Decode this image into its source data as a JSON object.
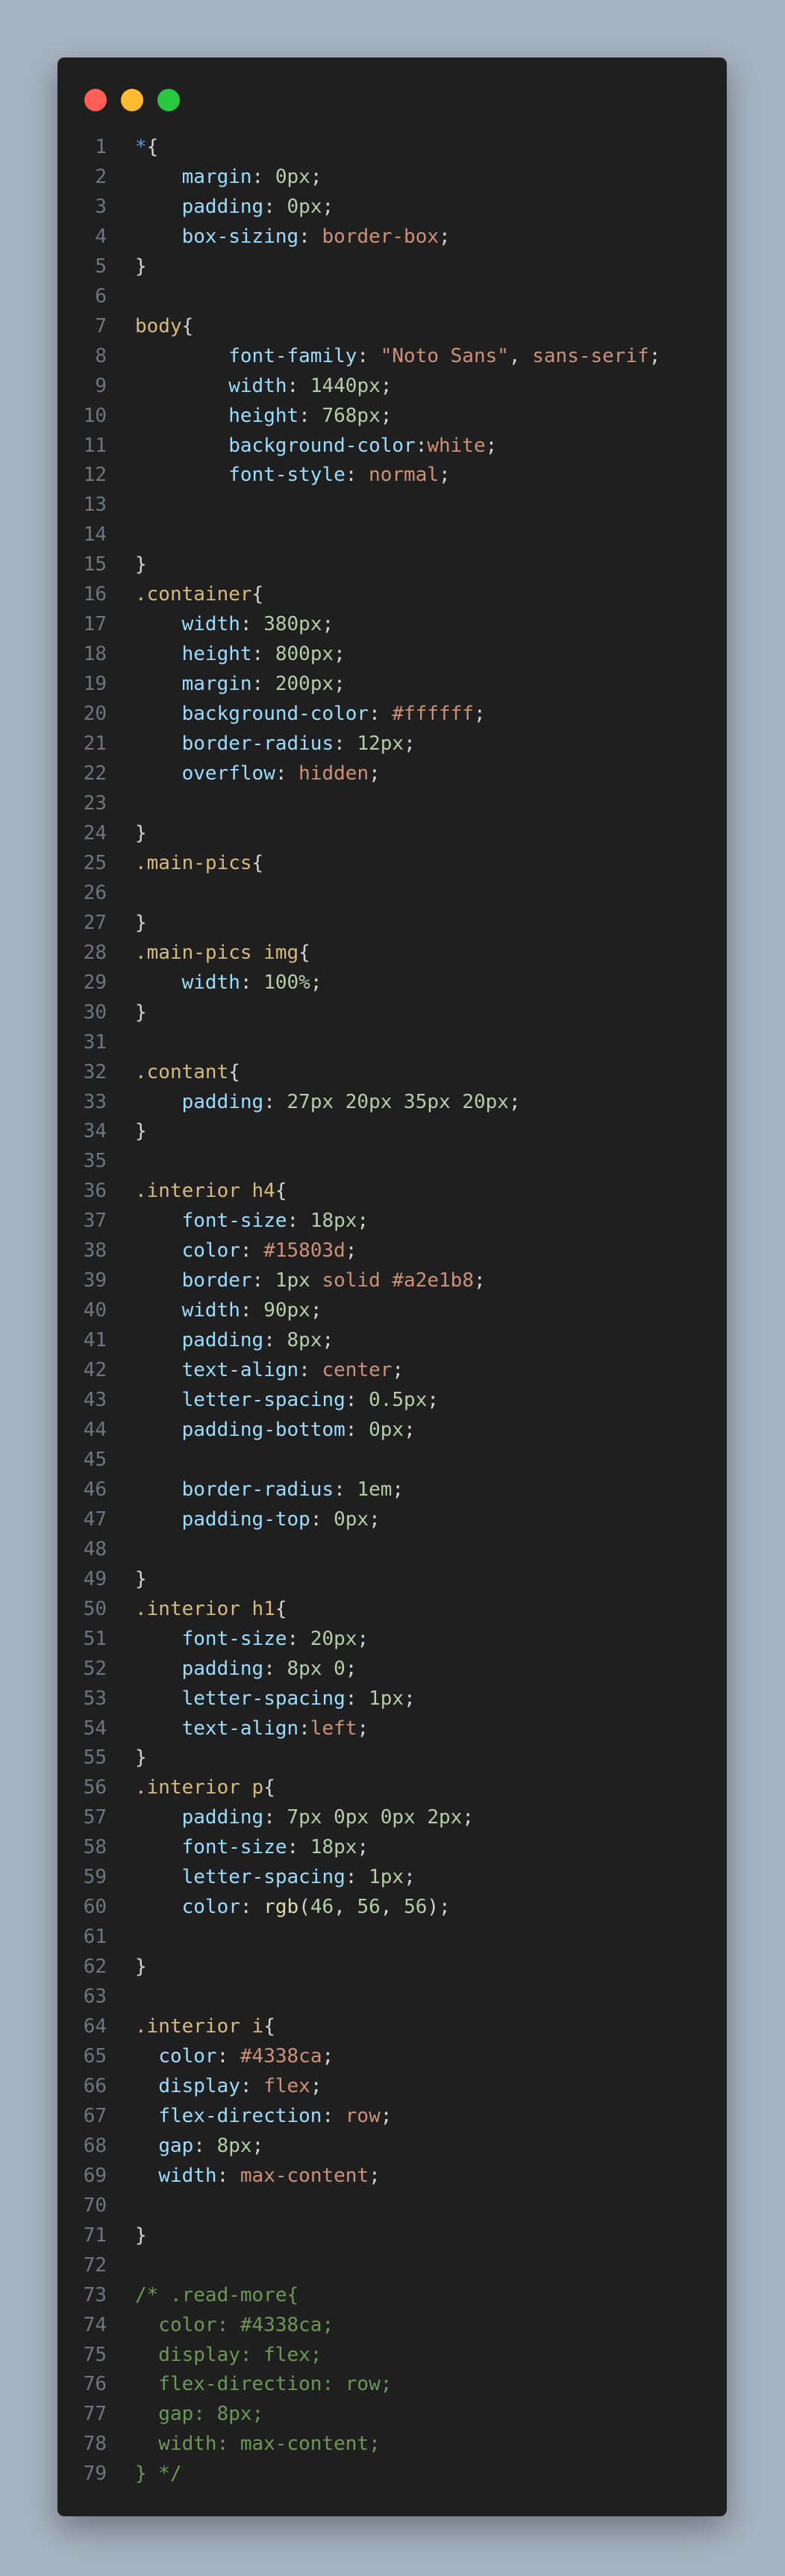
{
  "window": {
    "controls": [
      {
        "name": "close",
        "color": "#ff5f57"
      },
      {
        "name": "minimize",
        "color": "#febc2e"
      },
      {
        "name": "maximize",
        "color": "#28c840"
      }
    ]
  },
  "code": {
    "lines": [
      [
        {
          "t": "*",
          "c": "star"
        },
        {
          "t": "{",
          "c": "punc"
        }
      ],
      [
        {
          "t": "    ",
          "c": "plain"
        },
        {
          "t": "margin",
          "c": "prop"
        },
        {
          "t": ": ",
          "c": "punc"
        },
        {
          "t": "0px",
          "c": "num"
        },
        {
          "t": ";",
          "c": "punc"
        }
      ],
      [
        {
          "t": "    ",
          "c": "plain"
        },
        {
          "t": "padding",
          "c": "prop"
        },
        {
          "t": ": ",
          "c": "punc"
        },
        {
          "t": "0px",
          "c": "num"
        },
        {
          "t": ";",
          "c": "punc"
        }
      ],
      [
        {
          "t": "    ",
          "c": "plain"
        },
        {
          "t": "box-sizing",
          "c": "prop"
        },
        {
          "t": ": ",
          "c": "punc"
        },
        {
          "t": "border-box",
          "c": "val"
        },
        {
          "t": ";",
          "c": "punc"
        }
      ],
      [
        {
          "t": "}",
          "c": "punc"
        }
      ],
      [],
      [
        {
          "t": "body",
          "c": "sel"
        },
        {
          "t": "{",
          "c": "punc"
        }
      ],
      [
        {
          "t": "        ",
          "c": "plain"
        },
        {
          "t": "font-family",
          "c": "prop"
        },
        {
          "t": ": ",
          "c": "punc"
        },
        {
          "t": "\"Noto Sans\"",
          "c": "str"
        },
        {
          "t": ", ",
          "c": "punc"
        },
        {
          "t": "sans-serif",
          "c": "val"
        },
        {
          "t": ";",
          "c": "punc"
        }
      ],
      [
        {
          "t": "        ",
          "c": "plain"
        },
        {
          "t": "width",
          "c": "prop"
        },
        {
          "t": ": ",
          "c": "punc"
        },
        {
          "t": "1440px",
          "c": "num"
        },
        {
          "t": ";",
          "c": "punc"
        }
      ],
      [
        {
          "t": "        ",
          "c": "plain"
        },
        {
          "t": "height",
          "c": "prop"
        },
        {
          "t": ": ",
          "c": "punc"
        },
        {
          "t": "768px",
          "c": "num"
        },
        {
          "t": ";",
          "c": "punc"
        }
      ],
      [
        {
          "t": "        ",
          "c": "plain"
        },
        {
          "t": "background-color",
          "c": "prop"
        },
        {
          "t": ":",
          "c": "punc"
        },
        {
          "t": "white",
          "c": "val"
        },
        {
          "t": ";",
          "c": "punc"
        }
      ],
      [
        {
          "t": "        ",
          "c": "plain"
        },
        {
          "t": "font-style",
          "c": "prop"
        },
        {
          "t": ": ",
          "c": "punc"
        },
        {
          "t": "normal",
          "c": "val"
        },
        {
          "t": ";",
          "c": "punc"
        }
      ],
      [],
      [],
      [
        {
          "t": "}",
          "c": "punc"
        }
      ],
      [
        {
          "t": ".container",
          "c": "sel"
        },
        {
          "t": "{",
          "c": "punc"
        }
      ],
      [
        {
          "t": "    ",
          "c": "plain"
        },
        {
          "t": "width",
          "c": "prop"
        },
        {
          "t": ": ",
          "c": "punc"
        },
        {
          "t": "380px",
          "c": "num"
        },
        {
          "t": ";",
          "c": "punc"
        }
      ],
      [
        {
          "t": "    ",
          "c": "plain"
        },
        {
          "t": "height",
          "c": "prop"
        },
        {
          "t": ": ",
          "c": "punc"
        },
        {
          "t": "800px",
          "c": "num"
        },
        {
          "t": ";",
          "c": "punc"
        }
      ],
      [
        {
          "t": "    ",
          "c": "plain"
        },
        {
          "t": "margin",
          "c": "prop"
        },
        {
          "t": ": ",
          "c": "punc"
        },
        {
          "t": "200px",
          "c": "num"
        },
        {
          "t": ";",
          "c": "punc"
        }
      ],
      [
        {
          "t": "    ",
          "c": "plain"
        },
        {
          "t": "background-color",
          "c": "prop"
        },
        {
          "t": ": ",
          "c": "punc"
        },
        {
          "t": "#ffffff",
          "c": "val"
        },
        {
          "t": ";",
          "c": "punc"
        }
      ],
      [
        {
          "t": "    ",
          "c": "plain"
        },
        {
          "t": "border-radius",
          "c": "prop"
        },
        {
          "t": ": ",
          "c": "punc"
        },
        {
          "t": "12px",
          "c": "num"
        },
        {
          "t": ";",
          "c": "punc"
        }
      ],
      [
        {
          "t": "    ",
          "c": "plain"
        },
        {
          "t": "overflow",
          "c": "prop"
        },
        {
          "t": ": ",
          "c": "punc"
        },
        {
          "t": "hidden",
          "c": "val"
        },
        {
          "t": ";",
          "c": "punc"
        }
      ],
      [],
      [
        {
          "t": "}",
          "c": "punc"
        }
      ],
      [
        {
          "t": ".main-pics",
          "c": "sel"
        },
        {
          "t": "{",
          "c": "punc"
        }
      ],
      [],
      [
        {
          "t": "}",
          "c": "punc"
        }
      ],
      [
        {
          "t": ".main-pics img",
          "c": "sel"
        },
        {
          "t": "{",
          "c": "punc"
        }
      ],
      [
        {
          "t": "    ",
          "c": "plain"
        },
        {
          "t": "width",
          "c": "prop"
        },
        {
          "t": ": ",
          "c": "punc"
        },
        {
          "t": "100%",
          "c": "num"
        },
        {
          "t": ";",
          "c": "punc"
        }
      ],
      [
        {
          "t": "}",
          "c": "punc"
        }
      ],
      [],
      [
        {
          "t": ".contant",
          "c": "sel"
        },
        {
          "t": "{",
          "c": "punc"
        }
      ],
      [
        {
          "t": "    ",
          "c": "plain"
        },
        {
          "t": "padding",
          "c": "prop"
        },
        {
          "t": ": ",
          "c": "punc"
        },
        {
          "t": "27px 20px 35px 20px",
          "c": "num"
        },
        {
          "t": ";",
          "c": "punc"
        }
      ],
      [
        {
          "t": "}",
          "c": "punc"
        }
      ],
      [],
      [
        {
          "t": ".interior h4",
          "c": "sel"
        },
        {
          "t": "{",
          "c": "punc"
        }
      ],
      [
        {
          "t": "    ",
          "c": "plain"
        },
        {
          "t": "font-size",
          "c": "prop"
        },
        {
          "t": ": ",
          "c": "punc"
        },
        {
          "t": "18px",
          "c": "num"
        },
        {
          "t": ";",
          "c": "punc"
        }
      ],
      [
        {
          "t": "    ",
          "c": "plain"
        },
        {
          "t": "color",
          "c": "prop"
        },
        {
          "t": ": ",
          "c": "punc"
        },
        {
          "t": "#15803d",
          "c": "val"
        },
        {
          "t": ";",
          "c": "punc"
        }
      ],
      [
        {
          "t": "    ",
          "c": "plain"
        },
        {
          "t": "border",
          "c": "prop"
        },
        {
          "t": ": ",
          "c": "punc"
        },
        {
          "t": "1px",
          "c": "num"
        },
        {
          "t": " ",
          "c": "plain"
        },
        {
          "t": "solid #a2e1b8",
          "c": "val"
        },
        {
          "t": ";",
          "c": "punc"
        }
      ],
      [
        {
          "t": "    ",
          "c": "plain"
        },
        {
          "t": "width",
          "c": "prop"
        },
        {
          "t": ": ",
          "c": "punc"
        },
        {
          "t": "90px",
          "c": "num"
        },
        {
          "t": ";",
          "c": "punc"
        }
      ],
      [
        {
          "t": "    ",
          "c": "plain"
        },
        {
          "t": "padding",
          "c": "prop"
        },
        {
          "t": ": ",
          "c": "punc"
        },
        {
          "t": "8px",
          "c": "num"
        },
        {
          "t": ";",
          "c": "punc"
        }
      ],
      [
        {
          "t": "    ",
          "c": "plain"
        },
        {
          "t": "text-align",
          "c": "prop"
        },
        {
          "t": ": ",
          "c": "punc"
        },
        {
          "t": "center",
          "c": "val"
        },
        {
          "t": ";",
          "c": "punc"
        }
      ],
      [
        {
          "t": "    ",
          "c": "plain"
        },
        {
          "t": "letter-spacing",
          "c": "prop"
        },
        {
          "t": ": ",
          "c": "punc"
        },
        {
          "t": "0.5px",
          "c": "num"
        },
        {
          "t": ";",
          "c": "punc"
        }
      ],
      [
        {
          "t": "    ",
          "c": "plain"
        },
        {
          "t": "padding-bottom",
          "c": "prop"
        },
        {
          "t": ": ",
          "c": "punc"
        },
        {
          "t": "0px",
          "c": "num"
        },
        {
          "t": ";",
          "c": "punc"
        }
      ],
      [],
      [
        {
          "t": "    ",
          "c": "plain"
        },
        {
          "t": "border-radius",
          "c": "prop"
        },
        {
          "t": ": ",
          "c": "punc"
        },
        {
          "t": "1em",
          "c": "num"
        },
        {
          "t": ";",
          "c": "punc"
        }
      ],
      [
        {
          "t": "    ",
          "c": "plain"
        },
        {
          "t": "padding-top",
          "c": "prop"
        },
        {
          "t": ": ",
          "c": "punc"
        },
        {
          "t": "0px",
          "c": "num"
        },
        {
          "t": ";",
          "c": "punc"
        }
      ],
      [],
      [
        {
          "t": "}",
          "c": "punc"
        }
      ],
      [
        {
          "t": ".interior h1",
          "c": "sel"
        },
        {
          "t": "{",
          "c": "punc"
        }
      ],
      [
        {
          "t": "    ",
          "c": "plain"
        },
        {
          "t": "font-size",
          "c": "prop"
        },
        {
          "t": ": ",
          "c": "punc"
        },
        {
          "t": "20px",
          "c": "num"
        },
        {
          "t": ";",
          "c": "punc"
        }
      ],
      [
        {
          "t": "    ",
          "c": "plain"
        },
        {
          "t": "padding",
          "c": "prop"
        },
        {
          "t": ": ",
          "c": "punc"
        },
        {
          "t": "8px 0",
          "c": "num"
        },
        {
          "t": ";",
          "c": "punc"
        }
      ],
      [
        {
          "t": "    ",
          "c": "plain"
        },
        {
          "t": "letter-spacing",
          "c": "prop"
        },
        {
          "t": ": ",
          "c": "punc"
        },
        {
          "t": "1px",
          "c": "num"
        },
        {
          "t": ";",
          "c": "punc"
        }
      ],
      [
        {
          "t": "    ",
          "c": "plain"
        },
        {
          "t": "text-align",
          "c": "prop"
        },
        {
          "t": ":",
          "c": "punc"
        },
        {
          "t": "left",
          "c": "val"
        },
        {
          "t": ";",
          "c": "punc"
        }
      ],
      [
        {
          "t": "}",
          "c": "punc"
        }
      ],
      [
        {
          "t": ".interior p",
          "c": "sel"
        },
        {
          "t": "{",
          "c": "punc"
        }
      ],
      [
        {
          "t": "    ",
          "c": "plain"
        },
        {
          "t": "padding",
          "c": "prop"
        },
        {
          "t": ": ",
          "c": "punc"
        },
        {
          "t": "7px 0px 0px 2px",
          "c": "num"
        },
        {
          "t": ";",
          "c": "punc"
        }
      ],
      [
        {
          "t": "    ",
          "c": "plain"
        },
        {
          "t": "font-size",
          "c": "prop"
        },
        {
          "t": ": ",
          "c": "punc"
        },
        {
          "t": "18px",
          "c": "num"
        },
        {
          "t": ";",
          "c": "punc"
        }
      ],
      [
        {
          "t": "    ",
          "c": "plain"
        },
        {
          "t": "letter-spacing",
          "c": "prop"
        },
        {
          "t": ": ",
          "c": "punc"
        },
        {
          "t": "1px",
          "c": "num"
        },
        {
          "t": ";",
          "c": "punc"
        }
      ],
      [
        {
          "t": "    ",
          "c": "plain"
        },
        {
          "t": "color",
          "c": "prop"
        },
        {
          "t": ": ",
          "c": "punc"
        },
        {
          "t": "rgb",
          "c": "fn"
        },
        {
          "t": "(",
          "c": "punc"
        },
        {
          "t": "46",
          "c": "num"
        },
        {
          "t": ", ",
          "c": "punc"
        },
        {
          "t": "56",
          "c": "num"
        },
        {
          "t": ", ",
          "c": "punc"
        },
        {
          "t": "56",
          "c": "num"
        },
        {
          "t": ");",
          "c": "punc"
        }
      ],
      [],
      [
        {
          "t": "}",
          "c": "punc"
        }
      ],
      [],
      [
        {
          "t": ".interior i",
          "c": "sel"
        },
        {
          "t": "{",
          "c": "punc"
        }
      ],
      [
        {
          "t": "  ",
          "c": "plain"
        },
        {
          "t": "color",
          "c": "prop"
        },
        {
          "t": ": ",
          "c": "punc"
        },
        {
          "t": "#4338ca",
          "c": "val"
        },
        {
          "t": ";",
          "c": "punc"
        }
      ],
      [
        {
          "t": "  ",
          "c": "plain"
        },
        {
          "t": "display",
          "c": "prop"
        },
        {
          "t": ": ",
          "c": "punc"
        },
        {
          "t": "flex",
          "c": "val"
        },
        {
          "t": ";",
          "c": "punc"
        }
      ],
      [
        {
          "t": "  ",
          "c": "plain"
        },
        {
          "t": "flex-direction",
          "c": "prop"
        },
        {
          "t": ": ",
          "c": "punc"
        },
        {
          "t": "row",
          "c": "val"
        },
        {
          "t": ";",
          "c": "punc"
        }
      ],
      [
        {
          "t": "  ",
          "c": "plain"
        },
        {
          "t": "gap",
          "c": "prop"
        },
        {
          "t": ": ",
          "c": "punc"
        },
        {
          "t": "8px",
          "c": "num"
        },
        {
          "t": ";",
          "c": "punc"
        }
      ],
      [
        {
          "t": "  ",
          "c": "plain"
        },
        {
          "t": "width",
          "c": "prop"
        },
        {
          "t": ": ",
          "c": "punc"
        },
        {
          "t": "max-content",
          "c": "val"
        },
        {
          "t": ";",
          "c": "punc"
        }
      ],
      [],
      [
        {
          "t": "}",
          "c": "punc"
        }
      ],
      [],
      [
        {
          "t": "/* .read-more{",
          "c": "cmt"
        }
      ],
      [
        {
          "t": "  color: #4338ca;",
          "c": "cmt"
        }
      ],
      [
        {
          "t": "  display: flex;",
          "c": "cmt"
        }
      ],
      [
        {
          "t": "  flex-direction: row;",
          "c": "cmt"
        }
      ],
      [
        {
          "t": "  gap: 8px;",
          "c": "cmt"
        }
      ],
      [
        {
          "t": "  width: max-content;",
          "c": "cmt"
        }
      ],
      [
        {
          "t": "} */",
          "c": "cmt"
        }
      ]
    ]
  }
}
